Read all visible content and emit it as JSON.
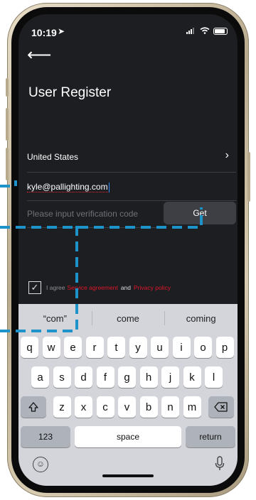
{
  "status_bar": {
    "time": "10:19",
    "location_icon": "location-arrow-icon"
  },
  "header": {
    "back_icon": "back-arrow-icon",
    "title": "User Register"
  },
  "form": {
    "country_label": "United States",
    "email_value": "kyle@pallighting.com",
    "code_placeholder": "Please input verification code",
    "get_button": "Get"
  },
  "agreement": {
    "prefix": "I agree",
    "service_link": "Service agreement",
    "and": "and",
    "privacy_link": "Privacy policy",
    "checked": true
  },
  "keyboard": {
    "suggestions": [
      "“com”",
      "come",
      "coming"
    ],
    "row1": [
      "q",
      "w",
      "e",
      "r",
      "t",
      "y",
      "u",
      "i",
      "o",
      "p"
    ],
    "row2": [
      "a",
      "s",
      "d",
      "f",
      "g",
      "h",
      "j",
      "k",
      "l"
    ],
    "row3": [
      "z",
      "x",
      "c",
      "v",
      "b",
      "n",
      "m"
    ],
    "numbers_label": "123",
    "space_label": "space",
    "return_label": "return"
  },
  "colors": {
    "accent_red": "#e0162a",
    "guide_blue": "#1e93c9",
    "screen_bg": "#1c1e22"
  }
}
